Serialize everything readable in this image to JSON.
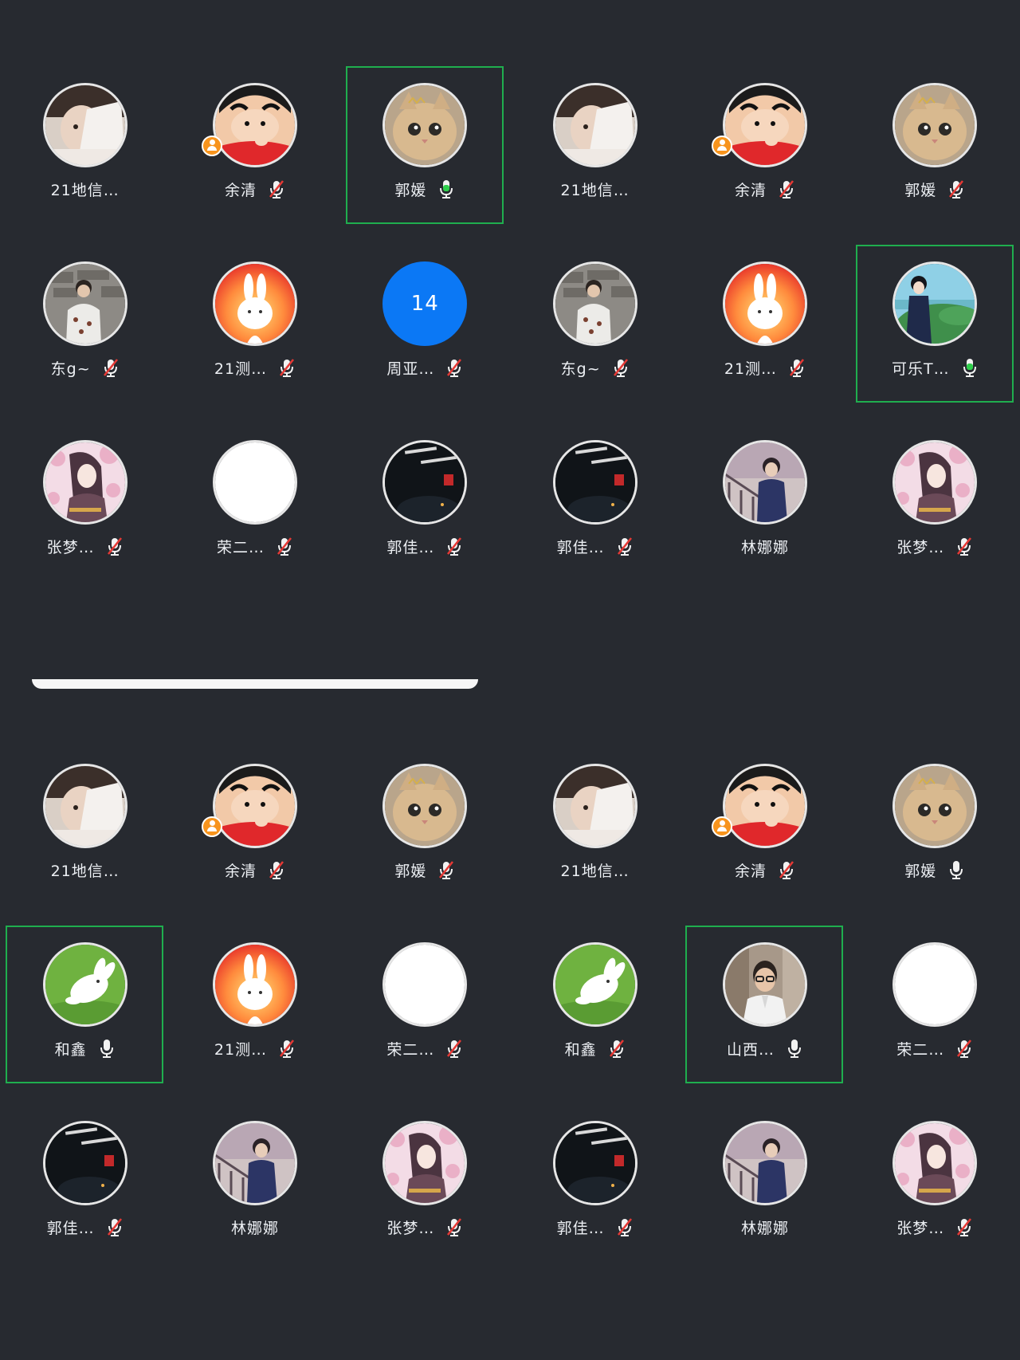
{
  "colors": {
    "background": "#272a30",
    "speaking_frame": "#1fae4e",
    "mic_active": "#2fcf4c",
    "mic_muted_slash": "#e53935",
    "host_badge": "#f7941d",
    "number_avatar": "#0b78f5"
  },
  "top_grid": {
    "tiles": [
      {
        "name": "21地信…",
        "avatar": "girl-photo",
        "mic": "none",
        "host": false,
        "speaking": false
      },
      {
        "name": "余清",
        "avatar": "crayon-boy",
        "mic": "muted",
        "host": true,
        "speaking": false
      },
      {
        "name": "郭媛",
        "avatar": "kitten",
        "mic": "active",
        "host": false,
        "speaking": true
      },
      {
        "name": "21地信…",
        "avatar": "girl-photo",
        "mic": "none",
        "host": false,
        "speaking": false
      },
      {
        "name": "余清",
        "avatar": "crayon-boy",
        "mic": "muted",
        "host": true,
        "speaking": false
      },
      {
        "name": "郭媛",
        "avatar": "kitten",
        "mic": "muted",
        "host": false,
        "speaking": false
      },
      {
        "name": "东g~",
        "avatar": "boy-wall",
        "mic": "muted",
        "host": false,
        "speaking": false
      },
      {
        "name": "21测…",
        "avatar": "sun-bunny",
        "mic": "muted",
        "host": false,
        "speaking": false
      },
      {
        "name": "周亚…",
        "avatar": "number",
        "avatar_text": "14",
        "mic": "muted",
        "host": false,
        "speaking": false
      },
      {
        "name": "东g~",
        "avatar": "boy-wall",
        "mic": "muted",
        "host": false,
        "speaking": false
      },
      {
        "name": "21测…",
        "avatar": "sun-bunny",
        "mic": "muted",
        "host": false,
        "speaking": false
      },
      {
        "name": "可乐T…",
        "avatar": "anime-girl-landscape",
        "mic": "active",
        "host": false,
        "speaking": true
      },
      {
        "name": "张梦…",
        "avatar": "blossom-girl",
        "mic": "muted",
        "host": false,
        "speaking": false
      },
      {
        "name": "荣二…",
        "avatar": "blank-white",
        "mic": "muted",
        "host": false,
        "speaking": false
      },
      {
        "name": "郭佳…",
        "avatar": "night-calligraphy",
        "mic": "muted",
        "host": false,
        "speaking": false
      },
      {
        "name": "郭佳…",
        "avatar": "night-calligraphy",
        "mic": "muted",
        "host": false,
        "speaking": false
      },
      {
        "name": "林娜娜",
        "avatar": "boy-railing",
        "mic": "none",
        "host": false,
        "speaking": false
      },
      {
        "name": "张梦…",
        "avatar": "blossom-girl",
        "mic": "muted",
        "host": false,
        "speaking": false
      }
    ]
  },
  "bottom_grid": {
    "tiles": [
      {
        "name": "21地信…",
        "avatar": "girl-photo",
        "mic": "none",
        "host": false,
        "speaking": false
      },
      {
        "name": "余清",
        "avatar": "crayon-boy",
        "mic": "muted",
        "host": true,
        "speaking": false
      },
      {
        "name": "郭媛",
        "avatar": "kitten",
        "mic": "muted",
        "host": false,
        "speaking": false
      },
      {
        "name": "21地信…",
        "avatar": "girl-photo",
        "mic": "none",
        "host": false,
        "speaking": false
      },
      {
        "name": "余清",
        "avatar": "crayon-boy",
        "mic": "muted",
        "host": true,
        "speaking": false
      },
      {
        "name": "郭媛",
        "avatar": "kitten",
        "mic": "on",
        "host": false,
        "speaking": false
      },
      {
        "name": "和鑫",
        "avatar": "green-bunny",
        "mic": "on",
        "host": false,
        "speaking": true
      },
      {
        "name": "21测…",
        "avatar": "sun-bunny",
        "mic": "muted",
        "host": false,
        "speaking": false
      },
      {
        "name": "荣二…",
        "avatar": "blank-white",
        "mic": "muted",
        "host": false,
        "speaking": false
      },
      {
        "name": "和鑫",
        "avatar": "green-bunny",
        "mic": "muted",
        "host": false,
        "speaking": false
      },
      {
        "name": "山西…",
        "avatar": "man-glasses",
        "mic": "on",
        "host": false,
        "speaking": true
      },
      {
        "name": "荣二…",
        "avatar": "blank-white",
        "mic": "muted",
        "host": false,
        "speaking": false
      },
      {
        "name": "郭佳…",
        "avatar": "night-calligraphy",
        "mic": "muted",
        "host": false,
        "speaking": false
      },
      {
        "name": "林娜娜",
        "avatar": "boy-railing",
        "mic": "none",
        "host": false,
        "speaking": false
      },
      {
        "name": "张梦…",
        "avatar": "blossom-girl",
        "mic": "muted",
        "host": false,
        "speaking": false
      },
      {
        "name": "郭佳…",
        "avatar": "night-calligraphy",
        "mic": "muted",
        "host": false,
        "speaking": false
      },
      {
        "name": "林娜娜",
        "avatar": "boy-railing",
        "mic": "none",
        "host": false,
        "speaking": false
      },
      {
        "name": "张梦…",
        "avatar": "blossom-girl",
        "mic": "muted",
        "host": false,
        "speaking": false
      }
    ]
  }
}
